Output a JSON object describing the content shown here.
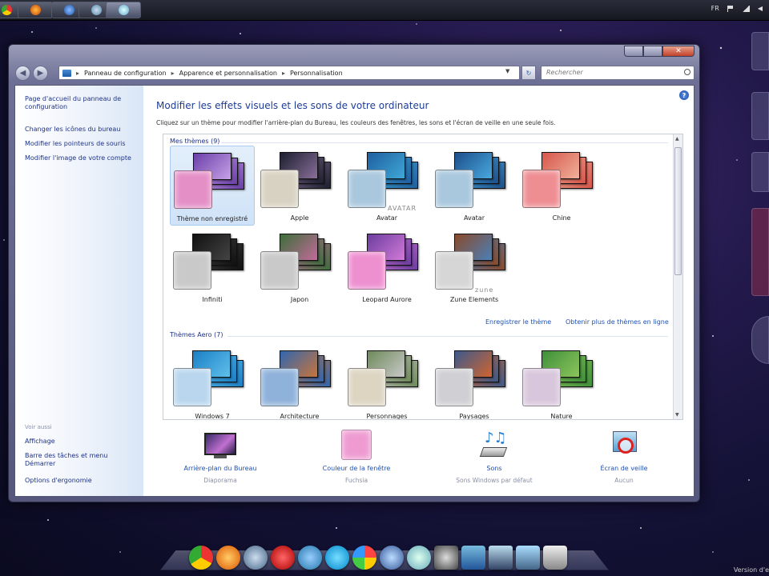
{
  "tray": {
    "language": "FR"
  },
  "address_bar": {
    "segments": [
      "Panneau de configuration",
      "Apparence et personnalisation",
      "Personnalisation"
    ]
  },
  "search": {
    "placeholder": "Rechercher"
  },
  "left_pane": {
    "links": [
      "Page d'accueil du panneau de configuration",
      "Changer les icônes du bureau",
      "Modifier les pointeurs de souris",
      "Modifier l'image de votre compte"
    ],
    "see_also_heading": "Voir aussi",
    "see_also_links": [
      "Affichage",
      "Barre des tâches et menu Démarrer",
      "Options d'ergonomie"
    ]
  },
  "main": {
    "title": "Modifier les effets visuels et les sons de votre ordinateur",
    "subtitle": "Cliquez sur un thème pour modifier l'arrière-plan du Bureau, les couleurs des fenêtres, les sons et l'écran de veille en une seule fois."
  },
  "my_themes": {
    "heading": "Mes thèmes (9)",
    "themes": [
      {
        "name": "Thème non enregistré",
        "swatch": "#e48fc6",
        "c1": "#6a3fa8",
        "c2": "#c7a2e8",
        "selected": true
      },
      {
        "name": "Apple",
        "swatch": "#d8d2c2",
        "c1": "#1b1f2e",
        "c2": "#8a6e9a",
        "selected": false
      },
      {
        "name": "Avatar",
        "swatch": "#a9c7dd",
        "c1": "#1f5fa0",
        "c2": "#3fa7d6",
        "selected": false,
        "brand": "AVATAR"
      },
      {
        "name": "Avatar",
        "swatch": "#a9c7dd",
        "c1": "#1d4f8a",
        "c2": "#48a8e0",
        "selected": false
      },
      {
        "name": "Chine",
        "swatch": "#ee8d92",
        "c1": "#d7564b",
        "c2": "#f0b19a",
        "selected": false
      },
      {
        "name": "Infiniti",
        "swatch": "#c9c9c9",
        "c1": "#111111",
        "c2": "#444444",
        "selected": false
      },
      {
        "name": "Japon",
        "swatch": "#c9c9c9",
        "c1": "#3c6e3a",
        "c2": "#c46a9a",
        "selected": false
      },
      {
        "name": "Leopard Aurore",
        "swatch": "#ee8fd0",
        "c1": "#6b3d9f",
        "c2": "#d27ad8",
        "selected": false
      },
      {
        "name": "Zune Elements",
        "swatch": "#d6d6d6",
        "c1": "#8a4a2a",
        "c2": "#4a7fb8",
        "selected": false,
        "brand": "zune"
      }
    ],
    "save_link": "Enregistrer le thème",
    "more_link": "Obtenir plus de thèmes en ligne"
  },
  "aero_themes": {
    "heading": "Thèmes Aero (7)",
    "themes": [
      {
        "name": "Windows 7",
        "swatch": "#b9d6ee",
        "c1": "#1b7fc6",
        "c2": "#5fc0ea"
      },
      {
        "name": "Architecture",
        "swatch": "#8fb2da",
        "c1": "#3066b0",
        "c2": "#c8743a"
      },
      {
        "name": "Personnages",
        "swatch": "#ddd5c2",
        "c1": "#6e8a5a",
        "c2": "#c8c8c8"
      },
      {
        "name": "Paysages",
        "swatch": "#d0cfd3",
        "c1": "#3c5a8c",
        "c2": "#d0642f"
      },
      {
        "name": "Nature",
        "swatch": "#d8c6dc",
        "c1": "#3f8f3a",
        "c2": "#8cc55c"
      }
    ]
  },
  "bottom": [
    {
      "label": "Arrière-plan du Bureau",
      "sub": "Diaporama",
      "icon": "desktop-background-icon"
    },
    {
      "label": "Couleur de la fenêtre",
      "sub": "Fuchsia",
      "icon": "window-color-icon",
      "color": "#ef9bd2"
    },
    {
      "label": "Sons",
      "sub": "Sons Windows par défaut",
      "icon": "sounds-icon"
    },
    {
      "label": "Écran de veille",
      "sub": "Aucun",
      "icon": "screensaver-icon"
    }
  ],
  "version_text": "Version d'e"
}
